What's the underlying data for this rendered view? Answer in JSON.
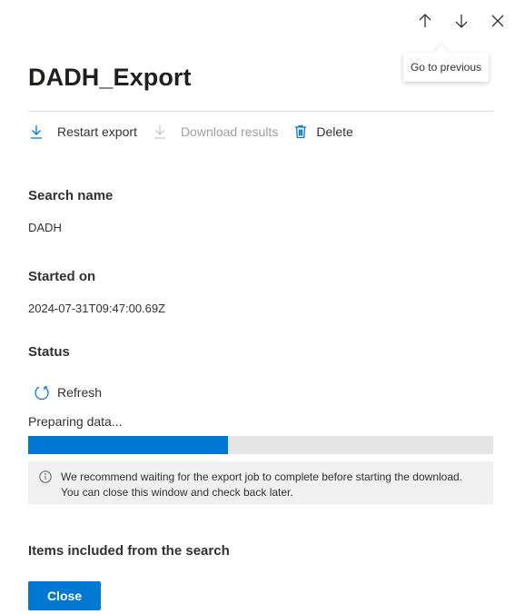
{
  "nav": {
    "previous_icon": "arrow-up-icon",
    "next_icon": "arrow-down-icon",
    "close_icon": "close-icon",
    "tooltip": "Go to previous"
  },
  "title": "DADH_Export",
  "toolbar": {
    "restart_label": "Restart export",
    "download_label": "Download results",
    "delete_label": "Delete"
  },
  "details": {
    "search_name_label": "Search name",
    "search_name_value": "DADH",
    "started_on_label": "Started on",
    "started_on_value": "2024-07-31T09:47:00.69Z",
    "status_label": "Status",
    "refresh_label": "Refresh",
    "status_text": "Preparing data...",
    "progress_fraction": 0.43
  },
  "info": {
    "line1": "We recommend waiting for the export job to complete before starting the download.",
    "line2": "You can close this window and check back later."
  },
  "items_label": "Items included from the search",
  "close_label": "Close",
  "colors": {
    "accent": "#0078d4",
    "progress_track": "#e6e6e6",
    "info_bg": "#f0f0f0",
    "disabled_text": "#a19f9d"
  }
}
